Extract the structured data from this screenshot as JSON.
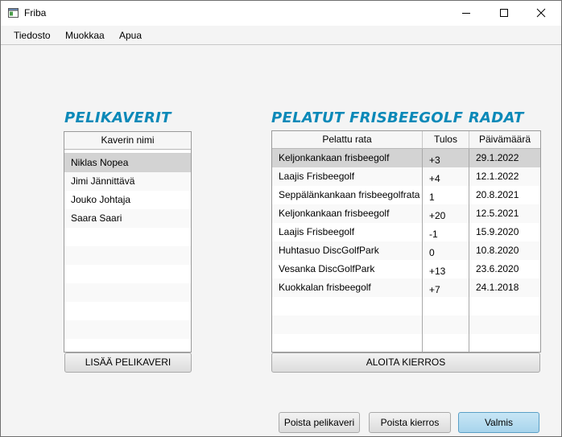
{
  "window": {
    "title": "Friba"
  },
  "menu": [
    "Tiedosto",
    "Muokkaa",
    "Apua"
  ],
  "friends": {
    "heading": "PELIKAVERIT",
    "column": "Kaverin nimi",
    "rows": [
      "Niklas Nopea",
      "Jimi Jännittävä",
      "Jouko Johtaja",
      "Saara Saari"
    ],
    "selected_index": 0,
    "add_button": "LISÄÄ PELIKAVERI"
  },
  "courses": {
    "heading": "PELATUT FRISBEEGOLF RADAT",
    "columns": [
      "Pelattu rata",
      "Tulos",
      "Päivämäärä"
    ],
    "rows": [
      [
        "Keljonkankaan frisbeegolf",
        "+3",
        "29.1.2022"
      ],
      [
        "Laajis Frisbeegolf",
        "+4",
        "12.1.2022"
      ],
      [
        "Seppälänkankaan frisbeegolfrata",
        "1",
        "20.8.2021"
      ],
      [
        "Keljonkankaan frisbeegolf",
        "+20",
        "12.5.2021"
      ],
      [
        "Laajis Frisbeegolf",
        "-1",
        "15.9.2020"
      ],
      [
        "Huhtasuo DiscGolfPark",
        "0",
        "10.8.2020"
      ],
      [
        "Vesanka DiscGolfPark",
        "+13",
        "23.6.2020"
      ],
      [
        "Kuokkalan frisbeegolf",
        "+7",
        "24.1.2018"
      ]
    ],
    "selected_index": 0,
    "start_button": "ALOITA KIERROS"
  },
  "footer": {
    "remove_friend": "Poista pelikaveri",
    "remove_round": "Poista kierros",
    "done": "Valmis"
  },
  "colors": {
    "heading": "#0b89b8",
    "selection": "#d3d3d3",
    "default_button": "#a7d4ec"
  }
}
